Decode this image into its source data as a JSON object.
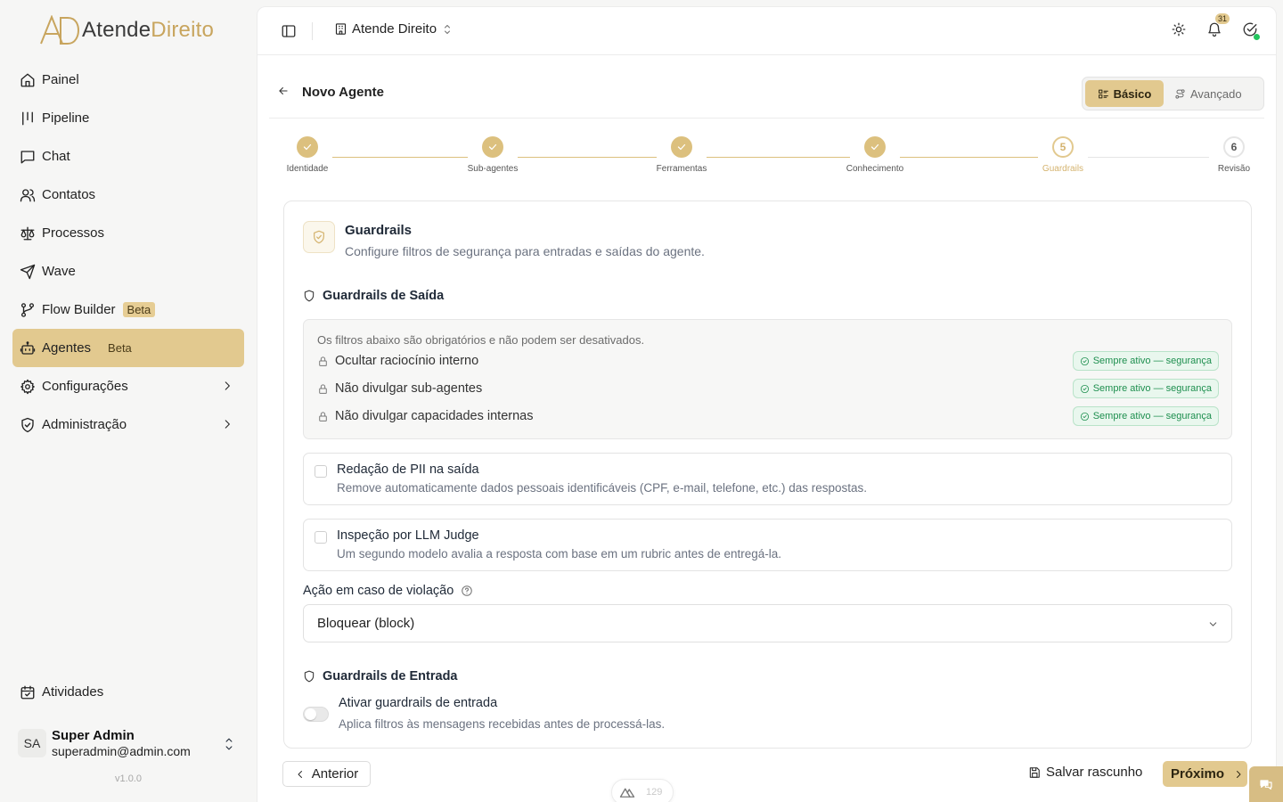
{
  "brand": {
    "name_part1": "Atende",
    "name_part2": "Direito",
    "accent_color": "#c8a55e",
    "primary_color": "#e2c98f"
  },
  "sidebar": {
    "items": [
      {
        "label": "Painel",
        "icon": "home-icon"
      },
      {
        "label": "Pipeline",
        "icon": "kanban-icon"
      },
      {
        "label": "Chat",
        "icon": "chat-icon"
      },
      {
        "label": "Contatos",
        "icon": "users-icon"
      },
      {
        "label": "Processos",
        "icon": "scale-icon"
      },
      {
        "label": "Wave",
        "icon": "send-icon"
      },
      {
        "label": "Flow Builder",
        "icon": "workflow-icon",
        "badge": "Beta"
      },
      {
        "label": "Agentes",
        "icon": "bot-icon",
        "badge": "Beta",
        "active": true
      },
      {
        "label": "Configurações",
        "icon": "gear-icon",
        "expandable": true
      },
      {
        "label": "Administração",
        "icon": "shield-icon",
        "expandable": true
      }
    ],
    "bottom_item": {
      "label": "Atividades",
      "icon": "calendar-icon"
    },
    "user": {
      "initials": "SA",
      "name": "Super Admin",
      "email": "superadmin@admin.com"
    },
    "version": "v1.0.0"
  },
  "topbar": {
    "org_name": "Atende Direito",
    "notification_count": "31"
  },
  "page": {
    "title": "Novo Agente",
    "modes": {
      "basic": "Básico",
      "advanced": "Avançado",
      "selected": "Básico"
    }
  },
  "stepper": {
    "steps": [
      {
        "number": "1",
        "label": "Identidade",
        "state": "done"
      },
      {
        "number": "2",
        "label": "Sub-agentes",
        "state": "done"
      },
      {
        "number": "3",
        "label": "Ferramentas",
        "state": "done"
      },
      {
        "number": "4",
        "label": "Conhecimento",
        "state": "done"
      },
      {
        "number": "5",
        "label": "Guardrails",
        "state": "current"
      },
      {
        "number": "6",
        "label": "Revisão",
        "state": "todo"
      }
    ]
  },
  "card": {
    "title": "Guardrails",
    "subtitle": "Configure filtros de segurança para entradas e saídas do agente.",
    "output_section": {
      "heading": "Guardrails de Saída",
      "locked_note": "Os filtros abaixo são obrigatórios e não podem ser desativados.",
      "locked_filters": [
        {
          "label": "Ocultar raciocínio interno",
          "badge": "Sempre ativo — segurança"
        },
        {
          "label": "Não divulgar sub-agentes",
          "badge": "Sempre ativo — segurança"
        },
        {
          "label": "Não divulgar capacidades internas",
          "badge": "Sempre ativo — segurança"
        }
      ],
      "options": [
        {
          "title": "Redação de PII na saída",
          "description": "Remove automaticamente dados pessoais identificáveis (CPF, e-mail, telefone, etc.) das respostas.",
          "checked": false
        },
        {
          "title": "Inspeção por LLM Judge",
          "description": "Um segundo modelo avalia a resposta com base em um rubric antes de entregá-la.",
          "checked": false
        }
      ],
      "violation_action": {
        "label": "Ação em caso de violação",
        "value": "Bloquear (block)"
      }
    },
    "input_section": {
      "heading": "Guardrails de Entrada",
      "toggle_title": "Ativar guardrails de entrada",
      "toggle_desc": "Aplica filtros às mensagens recebidas antes de processá-las.",
      "enabled": false
    }
  },
  "footer": {
    "prev_label": "Anterior",
    "draft_label": "Salvar rascunho",
    "next_label": "Próximo"
  },
  "debug_pill": {
    "count": "129"
  }
}
